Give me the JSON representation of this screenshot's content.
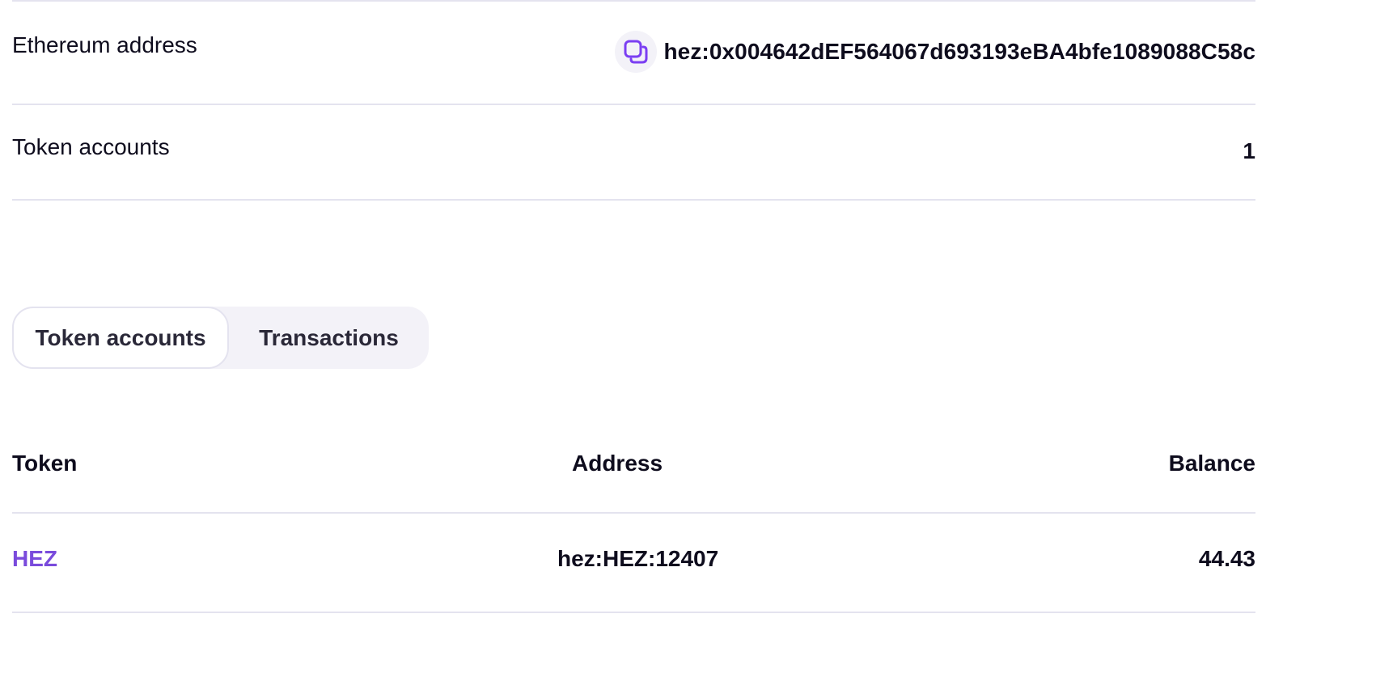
{
  "account": {
    "ethereum_label": "Ethereum address",
    "ethereum_value": "hez:0x004642dEF564067d693193eBA4bfe1089088C58c",
    "token_accounts_label": "Token accounts",
    "token_accounts_count": "1"
  },
  "tabs": [
    {
      "label": "Token accounts",
      "active": true
    },
    {
      "label": "Transactions",
      "active": false
    }
  ],
  "table": {
    "columns": [
      "Token",
      "Address",
      "Balance"
    ],
    "rows": [
      {
        "token": "HEZ",
        "address": "hez:HEZ:12407",
        "balance": "44.43"
      }
    ]
  },
  "colors": {
    "accent": "#7a4bdc",
    "copy_icon": "#7b3ff2",
    "divider": "#e4e3ef",
    "tab_bg": "#f3f2f8"
  },
  "icons": {
    "copy": "copy-icon"
  }
}
